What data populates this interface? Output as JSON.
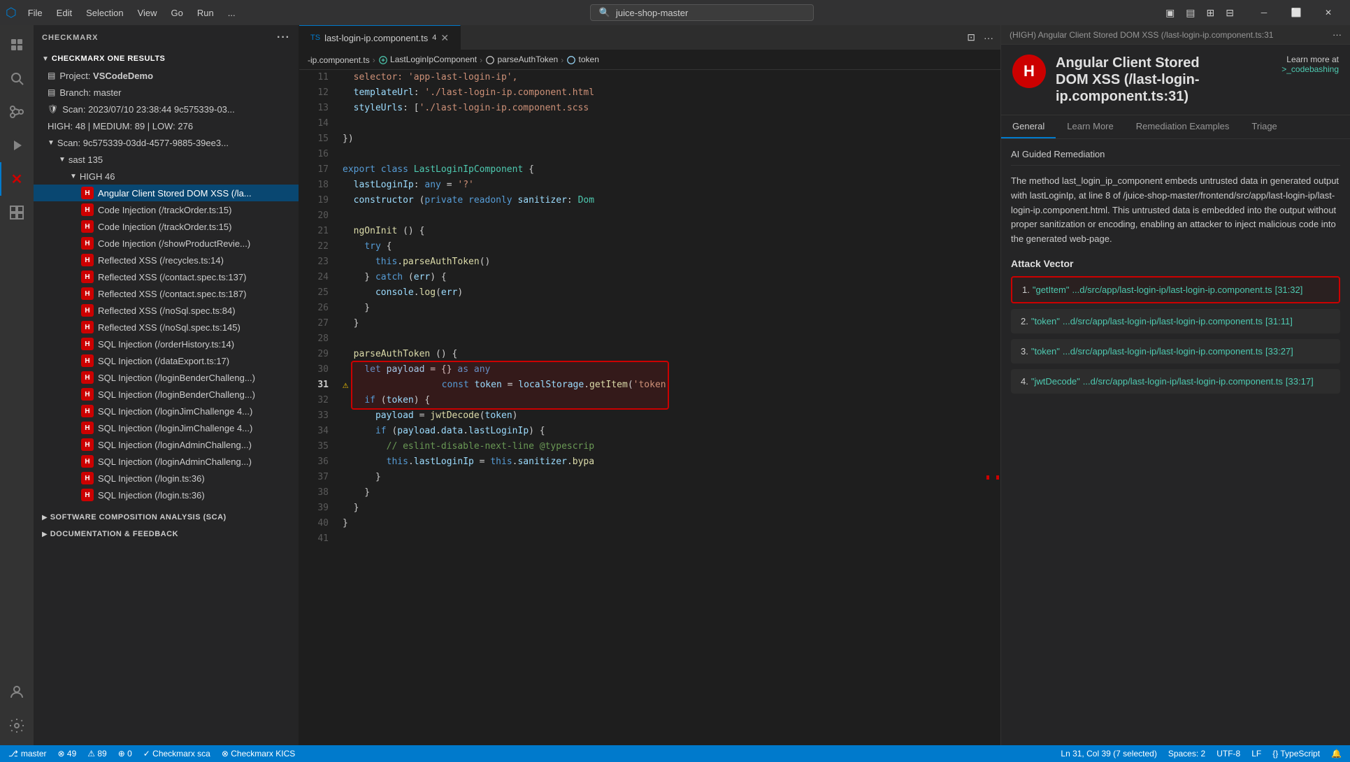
{
  "titlebar": {
    "menu_items": [
      "File",
      "Edit",
      "Selection",
      "View",
      "Go",
      "Run",
      "..."
    ],
    "search_placeholder": "juice-shop-master",
    "window_controls": [
      "—",
      "⬜",
      "✕"
    ]
  },
  "sidebar": {
    "header": "CHECKMARX",
    "results_header": "CHECKMARX ONE RESULTS",
    "project_label": "Project:",
    "project_value": "VSCodeDemo",
    "branch_label": "Branch:",
    "branch_value": "master",
    "scan_label": "Scan:",
    "scan_value": "2023/07/10 23:38:44 9c575339-03...",
    "high_label": "HIGH: 48 | MEDIUM: 89 | LOW: 276",
    "scan_id": "Scan: 9c575339-03dd-4577-9885-39ee3...",
    "sast_label": "sast",
    "sast_count": "135",
    "high_group": "HIGH",
    "high_count": "46",
    "vulnerabilities": [
      {
        "id": 1,
        "label": "Angular Client Stored DOM XSS (/la...",
        "severity": "H",
        "selected": true
      },
      {
        "id": 2,
        "label": "Code Injection (/trackOrder.ts:15)",
        "severity": "H",
        "selected": false
      },
      {
        "id": 3,
        "label": "Code Injection (/trackOrder.ts:15)",
        "severity": "H",
        "selected": false
      },
      {
        "id": 4,
        "label": "Code Injection (/showProductRevie...)",
        "severity": "H",
        "selected": false
      },
      {
        "id": 5,
        "label": "Reflected XSS (/recycles.ts:14)",
        "severity": "H",
        "selected": false
      },
      {
        "id": 6,
        "label": "Reflected XSS (/contact.spec.ts:137)",
        "severity": "H",
        "selected": false
      },
      {
        "id": 7,
        "label": "Reflected XSS (/contact.spec.ts:187)",
        "severity": "H",
        "selected": false
      },
      {
        "id": 8,
        "label": "Reflected XSS (/noSql.spec.ts:84)",
        "severity": "H",
        "selected": false
      },
      {
        "id": 9,
        "label": "Reflected XSS (/noSql.spec.ts:145)",
        "severity": "H",
        "selected": false
      },
      {
        "id": 10,
        "label": "SQL Injection (/orderHistory.ts:14)",
        "severity": "H",
        "selected": false
      },
      {
        "id": 11,
        "label": "SQL Injection (/dataExport.ts:17)",
        "severity": "H",
        "selected": false
      },
      {
        "id": 12,
        "label": "SQL Injection (/loginBenderChalleng...)",
        "severity": "H",
        "selected": false
      },
      {
        "id": 13,
        "label": "SQL Injection (/loginBenderChalleng...)",
        "severity": "H",
        "selected": false
      },
      {
        "id": 14,
        "label": "SQL Injection (/loginJimChallenge 4...)",
        "severity": "H",
        "selected": false
      },
      {
        "id": 15,
        "label": "SQL Injection (/loginJimChallenge 4...)",
        "severity": "H",
        "selected": false
      },
      {
        "id": 16,
        "label": "SQL Injection (/loginAdminChalleng...)",
        "severity": "H",
        "selected": false
      },
      {
        "id": 17,
        "label": "SQL Injection (/loginAdminChalleng...)",
        "severity": "H",
        "selected": false
      },
      {
        "id": 18,
        "label": "SQL Injection (/login.ts:36)",
        "severity": "H",
        "selected": false
      },
      {
        "id": 19,
        "label": "SQL Injection (/login.ts:36)",
        "severity": "H",
        "selected": false
      }
    ],
    "sca_header": "SOFTWARE COMPOSITION ANALYSIS (SCA)",
    "docs_header": "DOCUMENTATION & FEEDBACK"
  },
  "editor": {
    "tab_filename": "last-login-ip.component.ts",
    "tab_number": "4",
    "breadcrumb": [
      "-ip.component.ts",
      "LastLoginIpComponent",
      "parseAuthToken",
      "token"
    ],
    "lines": [
      {
        "num": 11,
        "code": "  selector: 'app-last-login-ip',"
      },
      {
        "num": 12,
        "code": "  templateUrl: './last-login-ip.component.html"
      },
      {
        "num": 13,
        "code": "  styleUrls: ['./last-login-ip.component.scss"
      },
      {
        "num": 14,
        "code": ""
      },
      {
        "num": 15,
        "code": "})"
      },
      {
        "num": 16,
        "code": ""
      },
      {
        "num": 17,
        "code": "export class LastLoginIpComponent {"
      },
      {
        "num": 18,
        "code": "  lastLoginIp: any = '?'"
      },
      {
        "num": 19,
        "code": "  constructor (private readonly sanitizer: Dom"
      },
      {
        "num": 20,
        "code": ""
      },
      {
        "num": 21,
        "code": "  ngOnInit () {"
      },
      {
        "num": 22,
        "code": "    try {"
      },
      {
        "num": 23,
        "code": "      this.parseAuthToken()"
      },
      {
        "num": 24,
        "code": "    } catch (err) {"
      },
      {
        "num": 25,
        "code": "      console.log(err)"
      },
      {
        "num": 26,
        "code": "    }"
      },
      {
        "num": 27,
        "code": "  }"
      },
      {
        "num": 28,
        "code": ""
      },
      {
        "num": 29,
        "code": "  parseAuthToken () {"
      },
      {
        "num": 30,
        "code": "    let payload = {} as any"
      },
      {
        "num": 31,
        "code": "    const token = localStorage.getItem('token",
        "highlighted": true
      },
      {
        "num": 32,
        "code": "    if (token) {"
      },
      {
        "num": 33,
        "code": "      payload = jwtDecode(token)"
      },
      {
        "num": 34,
        "code": "      if (payload.data.lastLoginIp) {"
      },
      {
        "num": 35,
        "code": "        // eslint-disable-next-line @typescrip"
      },
      {
        "num": 36,
        "code": "        this.lastLoginIp = this.sanitizer.bypa"
      },
      {
        "num": 37,
        "code": "      }"
      },
      {
        "num": 38,
        "code": "    }"
      },
      {
        "num": 39,
        "code": "  }"
      },
      {
        "num": 40,
        "code": "}"
      },
      {
        "num": 41,
        "code": ""
      }
    ]
  },
  "detail": {
    "panel_header": "(HIGH) Angular Client Stored DOM XSS (/last-login-ip.component.ts:31",
    "icon_letter": "H",
    "title_line1": "Angular Client Stored",
    "title_line2": "DOM XSS (/last-login-",
    "title_line3": "ip.component.ts:31)",
    "learn_more_at": "Learn more at",
    "codebashing_link": ">_codebashing",
    "tabs": [
      "General",
      "Learn More",
      "Remediation Examples",
      "Triage"
    ],
    "active_tab": "General",
    "ai_guided": "AI Guided Remediation",
    "description": "The method last_login_ip_component embeds untrusted data in generated output with lastLoginIp, at line 8 of /juice-shop-master/frontend/src/app/last-login-ip/last-login-ip.component.html. This untrusted data is embedded into the output without proper sanitization or encoding, enabling an attacker to inject malicious code into the generated web-page.",
    "attack_vector_title": "Attack Vector",
    "attack_vectors": [
      {
        "num": 1,
        "label": "\"getItem\"",
        "path": "...d/src/app/last-login-ip/last-login-ip.component.ts",
        "location": "[31:32]",
        "highlighted": true
      },
      {
        "num": 2,
        "label": "\"token\"",
        "path": "...d/src/app/last-login-ip/last-login-ip.component.ts",
        "location": "[31:11]",
        "highlighted": false
      },
      {
        "num": 3,
        "label": "\"token\"",
        "path": "...d/src/app/last-login-ip/last-login-ip.component.ts",
        "location": "[33:27]",
        "highlighted": false
      },
      {
        "num": 4,
        "label": "\"jwtDecode\"",
        "path": "...d/src/app/last-login-ip/last-login-ip.component.ts",
        "location": "[33:17]",
        "highlighted": false
      }
    ]
  },
  "statusbar": {
    "branch_icon": "⎇",
    "branch": "master",
    "errors": "⊗ 49",
    "warnings": "⚠ 89",
    "info": "⊕ 0",
    "checkmarx_sca": "✓  Checkmarx sca",
    "checkmarx_kics": "⊗  Checkmarx KICS",
    "right_items": [
      "Ln 31, Col 39 (7 selected)",
      "Spaces: 2",
      "UTF-8",
      "LF",
      "{} TypeScript",
      "🔔"
    ]
  }
}
